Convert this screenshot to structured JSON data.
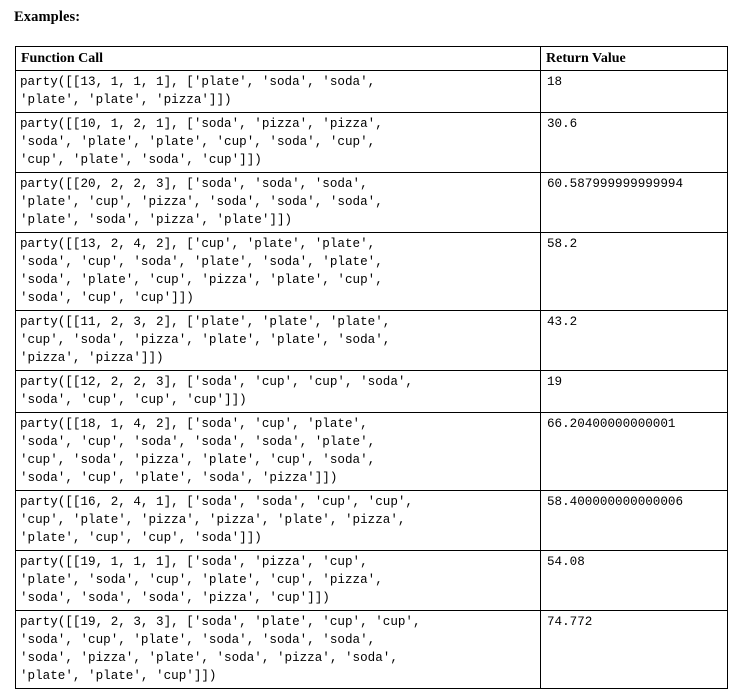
{
  "section": {
    "title": "Examples:"
  },
  "table": {
    "columns": [
      "Function Call",
      "Return Value"
    ],
    "rows": [
      {
        "call_lines": [
          "party([[13, 1, 1, 1], ['plate', 'soda', 'soda',",
          "'plate', 'plate', 'pizza']])"
        ],
        "return_value": "18"
      },
      {
        "call_lines": [
          "party([[10, 1, 2, 1], ['soda', 'pizza', 'pizza',",
          "'soda', 'plate', 'plate', 'cup', 'soda', 'cup',",
          "'cup', 'plate', 'soda', 'cup']])"
        ],
        "return_value": "30.6"
      },
      {
        "call_lines": [
          "party([[20, 2, 2, 3], ['soda', 'soda', 'soda',",
          "'plate', 'cup', 'pizza', 'soda', 'soda', 'soda',",
          "'plate', 'soda', 'pizza', 'plate']])"
        ],
        "return_value": "60.587999999999994"
      },
      {
        "call_lines": [
          "party([[13, 2, 4, 2], ['cup', 'plate', 'plate',",
          "'soda', 'cup', 'soda', 'plate', 'soda', 'plate',",
          "'soda', 'plate', 'cup', 'pizza', 'plate', 'cup',",
          "'soda', 'cup', 'cup']])"
        ],
        "return_value": "58.2"
      },
      {
        "call_lines": [
          "party([[11, 2, 3, 2], ['plate', 'plate', 'plate',",
          "'cup', 'soda', 'pizza', 'plate', 'plate', 'soda',",
          "'pizza', 'pizza']])"
        ],
        "return_value": "43.2"
      },
      {
        "call_lines": [
          "party([[12, 2, 2, 3], ['soda', 'cup', 'cup', 'soda',",
          "'soda', 'cup', 'cup', 'cup']])"
        ],
        "return_value": "19"
      },
      {
        "call_lines": [
          "party([[18, 1, 4, 2], ['soda', 'cup', 'plate',",
          "'soda', 'cup', 'soda', 'soda', 'soda', 'plate',",
          "'cup', 'soda', 'pizza', 'plate', 'cup', 'soda',",
          "'soda', 'cup', 'plate', 'soda', 'pizza']])"
        ],
        "return_value": "66.20400000000001"
      },
      {
        "call_lines": [
          "party([[16, 2, 4, 1], ['soda', 'soda', 'cup', 'cup',",
          "'cup', 'plate', 'pizza', 'pizza', 'plate', 'pizza',",
          "'plate', 'cup', 'cup', 'soda']])"
        ],
        "return_value": "58.400000000000006"
      },
      {
        "call_lines": [
          "party([[19, 1, 1, 1], ['soda', 'pizza', 'cup',",
          "'plate', 'soda', 'cup', 'plate', 'cup', 'pizza',",
          "'soda', 'soda', 'soda', 'pizza', 'cup']])"
        ],
        "return_value": "54.08"
      },
      {
        "call_lines": [
          "party([[19, 2, 3, 3], ['soda', 'plate', 'cup', 'cup',",
          "'soda', 'cup', 'plate', 'soda', 'soda', 'soda',",
          "'soda', 'pizza', 'plate', 'soda', 'pizza', 'soda',",
          "'plate', 'plate', 'cup']])"
        ],
        "return_value": "74.772"
      }
    ]
  }
}
